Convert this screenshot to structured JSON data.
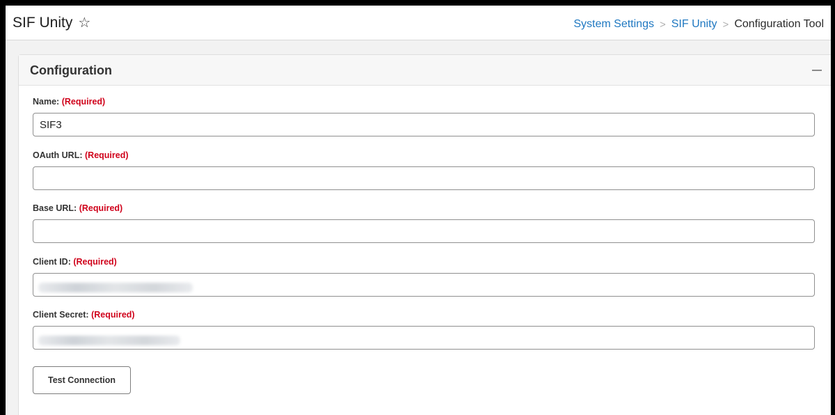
{
  "app": {
    "title": "SIF Unity",
    "favorite_icon": "star-outline-icon"
  },
  "breadcrumb": {
    "items": [
      "System Settings",
      "SIF Unity"
    ],
    "current": "Configuration Tool",
    "separator": ">",
    "link_color": "#1f78c1"
  },
  "panel": {
    "title": "Configuration",
    "collapse_icon": "minus-icon"
  },
  "form": {
    "required_text": "(Required)",
    "required_color": "#d0021b",
    "fields": [
      {
        "label": "Name:",
        "value": "SIF3",
        "obscured": false
      },
      {
        "label": "OAuth URL:",
        "value": "",
        "obscured": false
      },
      {
        "label": "Base URL:",
        "value": "",
        "obscured": false
      },
      {
        "label": "Client ID:",
        "value": "",
        "obscured": true
      },
      {
        "label": "Client Secret:",
        "value": "",
        "obscured": true
      }
    ],
    "test_button_label": "Test Connection"
  }
}
